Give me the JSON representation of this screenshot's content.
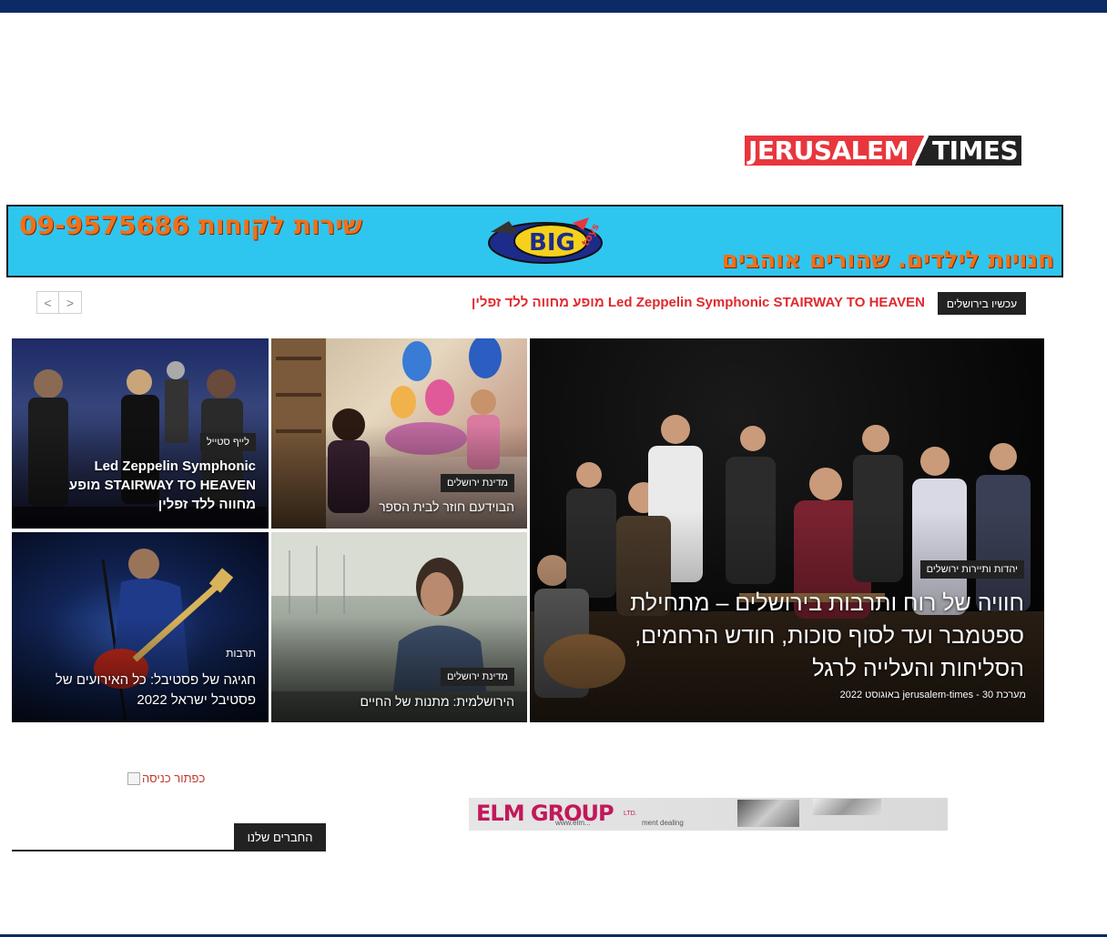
{
  "logo": {
    "word1": "JERUSALEM",
    "word2": "TIMES"
  },
  "banner": {
    "phone_text": "שירות לקוחות 09-9575686",
    "slogan": "חנויות לילדים. שהורים אוהבים",
    "brand": "BIG",
    "brand_sub": "toys"
  },
  "ticker": {
    "label": "עכשיו בירושלים",
    "headline": "Led Zeppelin Symphonic STAIRWAY TO HEAVEN מופע מחווה ללד זפלין",
    "prev": "<",
    "next": ">"
  },
  "tiles": {
    "main": {
      "category": "יהדות ותיירות ירושלים",
      "title": "חוויה של רוח ותרבות בירושלים – מתחילת ספטמבר ועד לסוף סוכות, חודש הרחמים, הסליחות והעלייה לרגל",
      "author": "מערכת jerusalem-times",
      "date": "30 באוגוסט 2022"
    },
    "kids": {
      "category": "מדינת ירושלים",
      "title": "הבוידעם חוזר לבית הספר"
    },
    "led": {
      "category": "לייף סטייל",
      "title": "Led Zeppelin Symphonic STAIRWAY TO HEAVEN מופע מחווה ללד זפלין"
    },
    "woman": {
      "category": "מדינת ירושלים",
      "title": "הירושלמית: מתנות של החיים"
    },
    "guitar": {
      "category": "תרבות",
      "title": "חגיגה של פסטיבל: כל האירועים של פסטיבל ישראל 2022"
    }
  },
  "sidebar": {
    "sponsor_alt": "כפתור כניסה",
    "partners_label": "החברים שלנו"
  },
  "ad": {
    "brand": "ELM GROUP",
    "suffix": "LTD.",
    "sub1": "www.elm...",
    "sub2": "ment  dealing"
  }
}
